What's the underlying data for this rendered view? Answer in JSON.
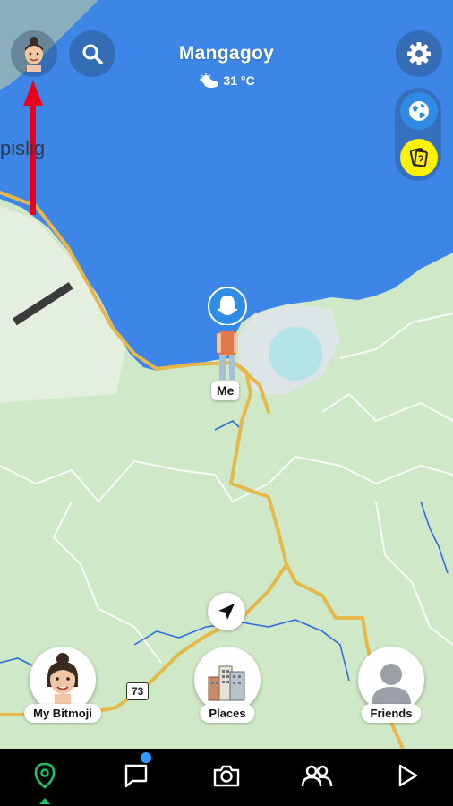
{
  "header": {
    "location_name": "Mangagoy",
    "temperature": "31 °C",
    "weather_icon": "partly-cloudy-icon"
  },
  "map": {
    "place_label_partial": "pislig",
    "me_label": "Me",
    "road_number": "73",
    "colors": {
      "water": "#3d86e8",
      "land": "#cfe8c8",
      "road": "#e6b84a",
      "boundary": "#ffffff",
      "annotation_arrow": "#e8001c"
    }
  },
  "side_buttons": {
    "globe_icon": "globe-icon",
    "memories_icon": "memories-icon"
  },
  "bottom_tiles": {
    "bitmoji": "My Bitmoji",
    "places": "Places",
    "friends": "Friends"
  },
  "navbar": {
    "items": [
      "map-icon",
      "chat-icon",
      "camera-icon",
      "friends-icon",
      "stories-icon"
    ],
    "active": "map",
    "active_color": "#1ec26a",
    "notification_color": "#2e9cff"
  }
}
